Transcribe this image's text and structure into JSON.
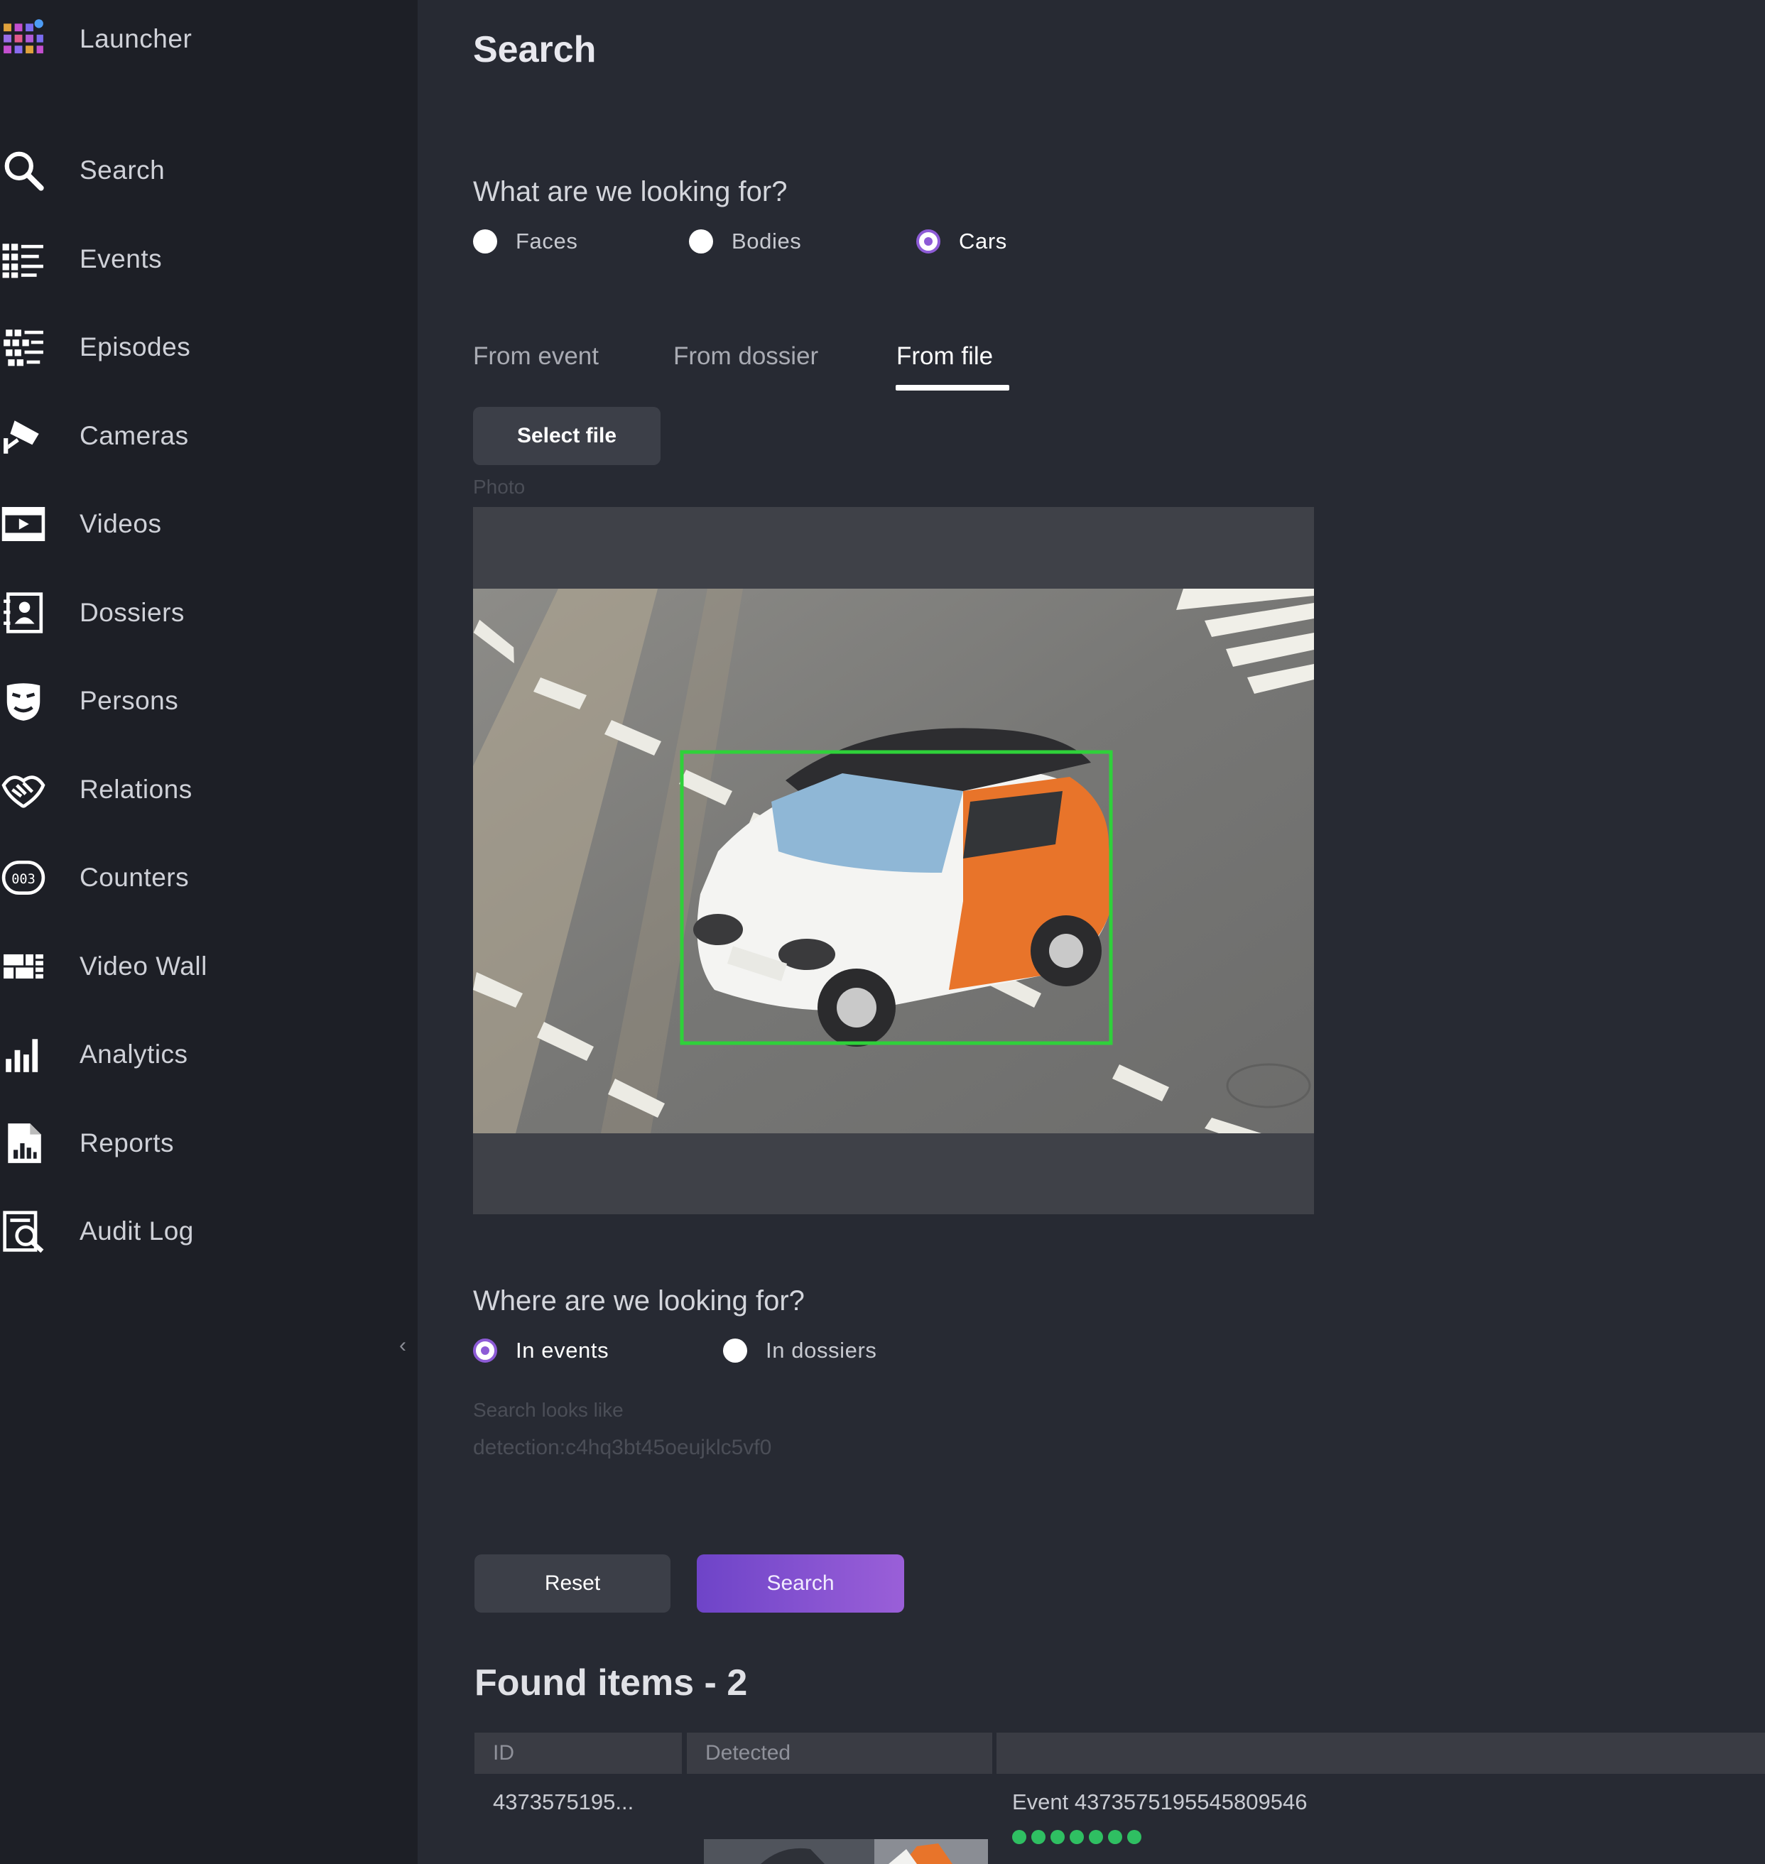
{
  "sidebar": {
    "items": [
      {
        "label": "Launcher",
        "icon": "launcher-grid-icon"
      },
      {
        "label": "Search",
        "icon": "search-icon"
      },
      {
        "label": "Events",
        "icon": "events-list-icon"
      },
      {
        "label": "Episodes",
        "icon": "episodes-icon"
      },
      {
        "label": "Cameras",
        "icon": "camera-icon"
      },
      {
        "label": "Videos",
        "icon": "film-icon"
      },
      {
        "label": "Dossiers",
        "icon": "dossier-icon"
      },
      {
        "label": "Persons",
        "icon": "mask-icon"
      },
      {
        "label": "Relations",
        "icon": "handshake-icon"
      },
      {
        "label": "Counters",
        "icon": "counter-icon"
      },
      {
        "label": "Video Wall",
        "icon": "video-wall-icon"
      },
      {
        "label": "Analytics",
        "icon": "bar-chart-icon"
      },
      {
        "label": "Reports",
        "icon": "report-icon"
      },
      {
        "label": "Audit Log",
        "icon": "audit-log-icon"
      }
    ],
    "collapse_glyph": "‹"
  },
  "main": {
    "title": "Search",
    "looking_for": {
      "label": "What are we looking for?",
      "options": [
        "Faces",
        "Bodies",
        "Cars"
      ],
      "selected": "Cars"
    },
    "tabs": [
      "From event",
      "From dossier",
      "From file"
    ],
    "active_tab": "From file",
    "select_file_label": "Select file",
    "photo_label": "Photo",
    "where_looking": {
      "label": "Where are we looking for?",
      "options": [
        "In events",
        "In dossiers"
      ],
      "selected": "In events"
    },
    "search_looks_like_label": "Search looks like",
    "search_looks_like_value": "detection:c4hq3bt45oeujklc5vf0",
    "reset_label": "Reset",
    "search_label": "Search",
    "found_title": "Found items - 2",
    "table": {
      "columns": [
        "ID",
        "Detected",
        ""
      ],
      "rows": [
        {
          "id": "4373575195...",
          "event": "Event 4373575195545809546",
          "confidence_dots": 7
        }
      ]
    }
  },
  "colors": {
    "accent": "#8d5bd6",
    "detection_box": "#2fd13a",
    "confidence": "#2fbf62",
    "background": "#272a33",
    "sidebar": "#1d1f26"
  }
}
